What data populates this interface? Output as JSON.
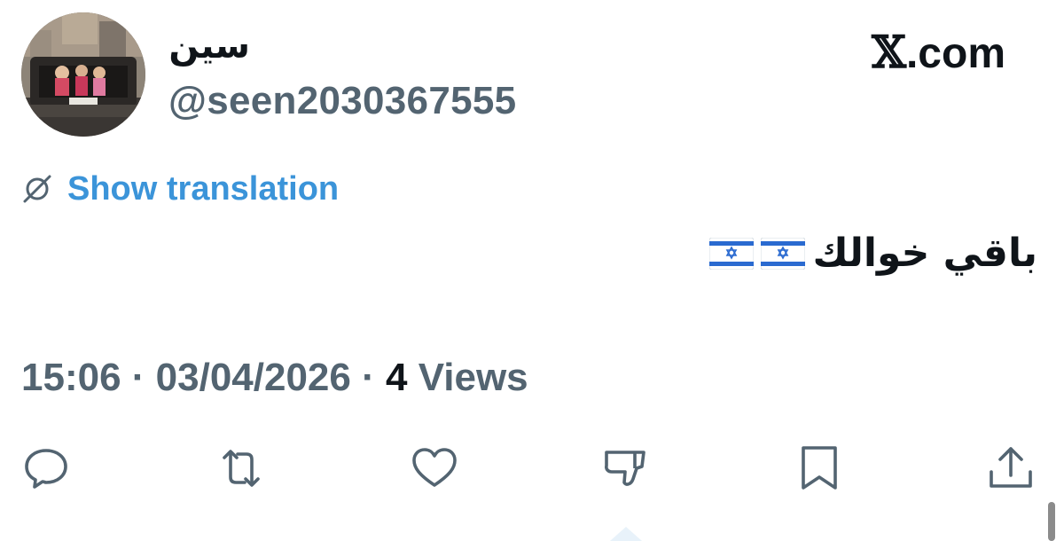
{
  "author": {
    "display_name": "سين",
    "handle": "@seen2030367555"
  },
  "brand": {
    "x_glyph": "𝕏",
    "domain": ".com"
  },
  "translation": {
    "link_label": "Show translation"
  },
  "tweet": {
    "text": "باقي خوالك",
    "emojis": [
      "israel-flag",
      "israel-flag"
    ]
  },
  "meta": {
    "time": "15:06",
    "separator": " · ",
    "date": "03/04/2026",
    "views_count": "4",
    "views_label": " Views"
  },
  "actions": [
    "reply-icon",
    "repost-icon",
    "like-icon",
    "dislike-icon",
    "bookmark-icon",
    "share-icon"
  ],
  "colors": {
    "text_primary": "#0f1419",
    "text_secondary": "#536471",
    "link": "#3b94d9",
    "icon": "#536471"
  }
}
